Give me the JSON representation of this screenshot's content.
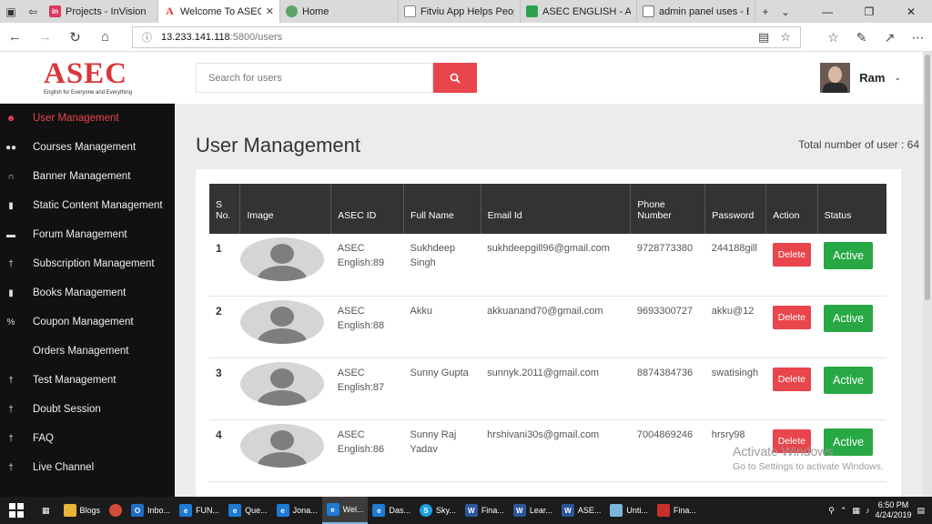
{
  "browser": {
    "tabs": [
      {
        "title": "Projects - InVision",
        "icon": "invision-icon",
        "color": "#dc395f",
        "glyph": "in",
        "active": false
      },
      {
        "title": "Welcome To ASEC",
        "icon": "asec-icon",
        "color": "#ffffff",
        "glyph": "A",
        "active": true
      },
      {
        "title": "Home",
        "icon": "home-site-icon",
        "color": "#5aa469",
        "glyph": "",
        "active": false
      },
      {
        "title": "Fitviu App Helps People",
        "icon": "fitviu-icon",
        "color": "#444444",
        "glyph": "",
        "active": false
      },
      {
        "title": "ASEC ENGLISH - Apps c",
        "icon": "play-store-icon",
        "color": "#2ca24f",
        "glyph": "",
        "active": false
      },
      {
        "title": "admin panel uses - Bin",
        "icon": "bing-icon",
        "color": "#444444",
        "glyph": "",
        "active": false
      }
    ],
    "url_host": "13.233.141.118",
    "url_path": ":5800/users"
  },
  "sidebar": {
    "logo_text": "ASEC",
    "logo_tagline": "English for Everyone and Everything",
    "items": [
      {
        "label": "User Management",
        "icon": "user-icon",
        "glyph": "●",
        "active": true
      },
      {
        "label": "Courses Management",
        "icon": "users-icon",
        "glyph": "●●",
        "active": false
      },
      {
        "label": "Banner Management",
        "icon": "headphones-icon",
        "glyph": "∩",
        "active": false
      },
      {
        "label": "Static Content Management",
        "icon": "file-icon",
        "glyph": "▮",
        "active": false
      },
      {
        "label": "Forum Management",
        "icon": "comment-icon",
        "glyph": "▬",
        "active": false
      },
      {
        "label": "Subscription Management",
        "icon": "male-icon",
        "glyph": "†",
        "active": false
      },
      {
        "label": "Books Management",
        "icon": "book-icon",
        "glyph": "▮",
        "active": false
      },
      {
        "label": "Coupon Management",
        "icon": "percent-icon",
        "glyph": "%",
        "active": false
      },
      {
        "label": "Orders Management",
        "icon": "",
        "glyph": "",
        "active": false
      },
      {
        "label": "Test Management",
        "icon": "male-icon",
        "glyph": "†",
        "active": false
      },
      {
        "label": "Doubt Session",
        "icon": "male-icon",
        "glyph": "†",
        "active": false
      },
      {
        "label": "FAQ",
        "icon": "male-icon",
        "glyph": "†",
        "active": false
      },
      {
        "label": "Live Channel",
        "icon": "male-icon",
        "glyph": "†",
        "active": false
      }
    ]
  },
  "header": {
    "search_placeholder": "Search for users",
    "user_name": "Ram"
  },
  "main": {
    "title": "User Management",
    "total_label": "Total number of user : 64",
    "table": {
      "columns": [
        "S No.",
        "Image",
        "ASEC ID",
        "Full Name",
        "Email Id",
        "Phone Number",
        "Password",
        "Action",
        "Status"
      ],
      "rows": [
        {
          "sno": "1",
          "asec_id": "ASEC English:89",
          "name": "Sukhdeep Singh",
          "email": "sukhdeepgill96@gmail.com",
          "phone": "9728773380",
          "password": "244188gill",
          "action": "Delete",
          "status": "Active"
        },
        {
          "sno": "2",
          "asec_id": "ASEC English:88",
          "name": "Akku",
          "email": "akkuanand70@gmail.com",
          "phone": "9693300727",
          "password": "akku@12",
          "action": "Delete",
          "status": "Active"
        },
        {
          "sno": "3",
          "asec_id": "ASEC English:87",
          "name": "Sunny Gupta",
          "email": "sunnyk.2011@gmail.com",
          "phone": "8874384736",
          "password": "swatisingh",
          "action": "Delete",
          "status": "Active"
        },
        {
          "sno": "4",
          "asec_id": "ASEC English:86",
          "name": "Sunny Raj Yadav",
          "email": "hrshivani30s@gmail.com",
          "phone": "7004869246",
          "password": "hrsry98",
          "action": "Delete",
          "status": "Active"
        }
      ]
    }
  },
  "watermark": {
    "line1": "Activate Windows",
    "line2": "Go to Settings to activate Windows."
  },
  "taskbar": {
    "items": [
      {
        "label": "Blogs",
        "icon": "folder-icon",
        "color": "#e9b43a",
        "glyph": "",
        "active": false
      },
      {
        "label": "",
        "icon": "chrome-icon",
        "color": "#d54c3b",
        "glyph": "",
        "active": false
      },
      {
        "label": "Inbo...",
        "icon": "outlook-icon",
        "color": "#1f6fc4",
        "glyph": "O",
        "active": false
      },
      {
        "label": "FUN...",
        "icon": "ie-icon",
        "color": "#1f7ad4",
        "glyph": "e",
        "active": false
      },
      {
        "label": "Que...",
        "icon": "ie-icon",
        "color": "#1f7ad4",
        "glyph": "e",
        "active": false
      },
      {
        "label": "Jona...",
        "icon": "ie-icon",
        "color": "#1f7ad4",
        "glyph": "e",
        "active": false
      },
      {
        "label": "Wel...",
        "icon": "edge-icon",
        "color": "#1f7ad4",
        "glyph": "e",
        "active": true
      },
      {
        "label": "Das...",
        "icon": "edge-icon",
        "color": "#1f7ad4",
        "glyph": "e",
        "active": false
      },
      {
        "label": "Sky...",
        "icon": "skype-icon",
        "color": "#1ba1e2",
        "glyph": "S",
        "active": false
      },
      {
        "label": "Fina...",
        "icon": "word-icon",
        "color": "#2b579a",
        "glyph": "W",
        "active": false
      },
      {
        "label": "Lear...",
        "icon": "word-icon",
        "color": "#2b579a",
        "glyph": "W",
        "active": false
      },
      {
        "label": "ASE...",
        "icon": "word-icon",
        "color": "#2b579a",
        "glyph": "W",
        "active": false
      },
      {
        "label": "Unti...",
        "icon": "paint-icon",
        "color": "#7ab6d9",
        "glyph": "",
        "active": false
      },
      {
        "label": "Fina...",
        "icon": "pdf-icon",
        "color": "#c9302c",
        "glyph": "",
        "active": false
      }
    ],
    "time": "6:50 PM",
    "date": "4/24/2019"
  }
}
